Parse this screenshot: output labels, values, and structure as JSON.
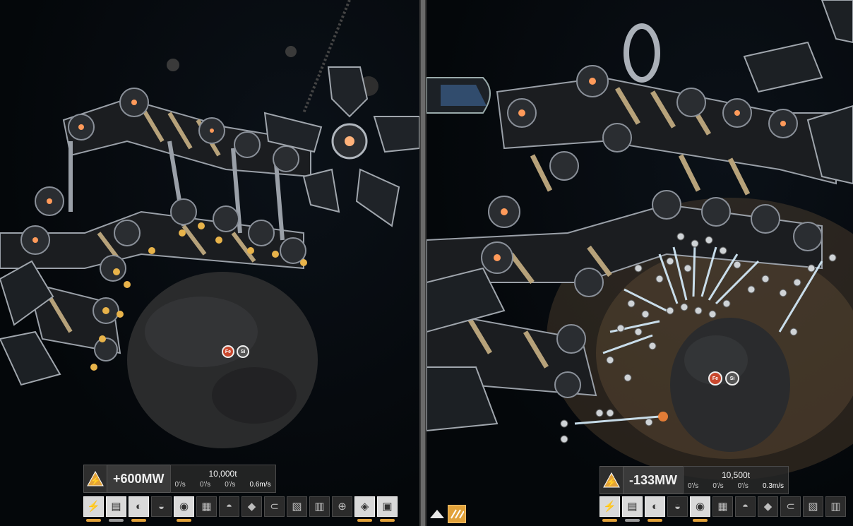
{
  "left_view": {
    "hud": {
      "power": "+600MW",
      "mass": "10,000t",
      "rates": [
        "0'/s",
        "0'/s",
        "0'/s",
        "0.6m/s"
      ]
    },
    "asteroid_tags": [
      "Fe",
      "Si"
    ]
  },
  "right_view": {
    "hud": {
      "power": "-133MW",
      "mass": "10,500t",
      "rates": [
        "0'/s",
        "0'/s",
        "0'/s",
        "0.3m/s"
      ]
    },
    "asteroid_tags": [
      "Fe",
      "Si"
    ]
  },
  "toolbar_left": [
    {
      "icon": "power-warning-icon",
      "glyph": "⚡",
      "active": true,
      "indicator": "orange"
    },
    {
      "icon": "screen-icon",
      "glyph": "▤",
      "active": true,
      "indicator": "grey"
    },
    {
      "icon": "magnet-icon",
      "glyph": "◐",
      "active": true,
      "indicator": "orange"
    },
    {
      "icon": "scanner-icon",
      "glyph": "◒",
      "active": false,
      "indicator": "none"
    },
    {
      "icon": "drone-icon",
      "glyph": "◉",
      "active": true,
      "indicator": "orange"
    },
    {
      "icon": "mining-icon",
      "glyph": "▦",
      "active": false,
      "indicator": "none"
    },
    {
      "icon": "refinery-icon",
      "glyph": "◓",
      "active": false,
      "indicator": "none"
    },
    {
      "icon": "tool-icon",
      "glyph": "◆",
      "active": false,
      "indicator": "none"
    },
    {
      "icon": "hook-icon",
      "glyph": "⊂",
      "active": false,
      "indicator": "none"
    },
    {
      "icon": "cargo-icon",
      "glyph": "▧",
      "active": false,
      "indicator": "none"
    },
    {
      "icon": "module-icon",
      "glyph": "▥",
      "active": false,
      "indicator": "none"
    },
    {
      "icon": "target-icon",
      "glyph": "⊕",
      "active": false,
      "indicator": "none"
    },
    {
      "icon": "directional-icon",
      "glyph": "◈",
      "active": true,
      "indicator": "orange"
    },
    {
      "icon": "camera-icon",
      "glyph": "▣",
      "active": true,
      "indicator": "orange"
    }
  ],
  "toolbar_right": [
    {
      "icon": "power-warning-icon",
      "glyph": "⚡",
      "active": true,
      "indicator": "orange"
    },
    {
      "icon": "screen-icon",
      "glyph": "▤",
      "active": true,
      "indicator": "grey"
    },
    {
      "icon": "magnet-icon",
      "glyph": "◐",
      "active": true,
      "indicator": "orange"
    },
    {
      "icon": "scanner-icon",
      "glyph": "◒",
      "active": false,
      "indicator": "none"
    },
    {
      "icon": "drone-icon",
      "glyph": "◉",
      "active": true,
      "indicator": "orange"
    },
    {
      "icon": "mining-icon",
      "glyph": "▦",
      "active": false,
      "indicator": "none"
    },
    {
      "icon": "refinery-icon",
      "glyph": "◓",
      "active": false,
      "indicator": "none"
    },
    {
      "icon": "tool-icon",
      "glyph": "◆",
      "active": false,
      "indicator": "none"
    },
    {
      "icon": "hook-icon",
      "glyph": "⊂",
      "active": false,
      "indicator": "none"
    },
    {
      "icon": "cargo-icon",
      "glyph": "▧",
      "active": false,
      "indicator": "none"
    },
    {
      "icon": "module-icon",
      "glyph": "▥",
      "active": false,
      "indicator": "none"
    }
  ],
  "colors": {
    "accent": "#e2a23a",
    "warning_red": "#d6452a",
    "beam": "#d8f0ff",
    "structure_gold": "#b7a27a"
  }
}
